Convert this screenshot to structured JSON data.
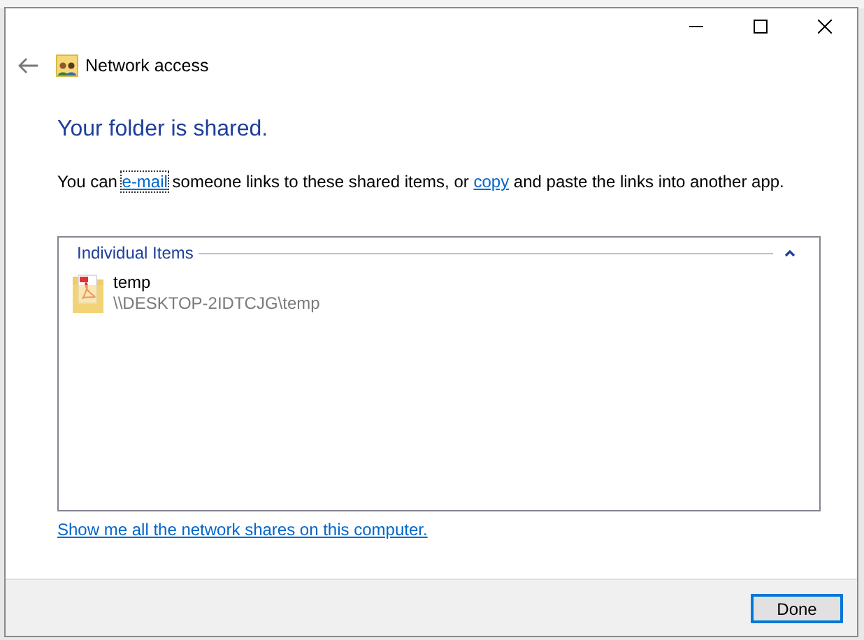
{
  "window": {
    "title": "Network access"
  },
  "heading": "Your folder is shared.",
  "message": {
    "before": "You can ",
    "email_link": "e-mail",
    "middle": " someone links to these shared items, or ",
    "copy_link": "copy",
    "after": " and paste the links into another app."
  },
  "group": {
    "title": "Individual Items",
    "expanded": true,
    "items": [
      {
        "name": "temp",
        "path": "\\\\DESKTOP-2IDTCJG\\temp"
      }
    ]
  },
  "shares_link": "Show me all the network shares on this computer.",
  "buttons": [
    {
      "label": "Done",
      "default": true
    }
  ]
}
